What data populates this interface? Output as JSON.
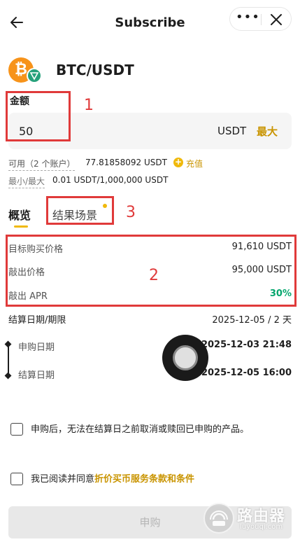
{
  "header": {
    "title": "Subscribe",
    "more_glyph": "•••",
    "back_icon": "arrow-left-icon",
    "close_icon": "close-icon"
  },
  "pair": {
    "name": "BTC/USDT",
    "base_glyph": "₿",
    "base_color": "#f7931a",
    "quote_color": "#26a17b"
  },
  "amount": {
    "label": "金额",
    "value": "50",
    "unit": "USDT",
    "max_label": "最大"
  },
  "available": {
    "label": "可用（2 个账户）",
    "value": "77.81858092 USDT",
    "recharge_label": "充值",
    "minmax_label": "最小/最大",
    "minmax_value": "0.01 USDT/1,000,000 USDT"
  },
  "tabs": [
    {
      "label": "概览",
      "active": true
    },
    {
      "label": "结果场景",
      "active": false
    }
  ],
  "details": [
    {
      "label": "目标购买价格",
      "value": "91,610 USDT"
    },
    {
      "label": "敲出价格",
      "value": "95,000 USDT"
    },
    {
      "label": "敲出 APR",
      "value": "30%"
    }
  ],
  "settlement": {
    "label": "结算日期/期限",
    "value": "2025-12-05 / 2 天"
  },
  "timeline": [
    {
      "label": "申购日期",
      "value": "2025-12-03 21:48"
    },
    {
      "label": "结算日期",
      "value": "2025-12-05 16:00"
    }
  ],
  "agreements": {
    "notice": "申购后，无法在结算日之前取消或赎回已申购的产品。",
    "read_prefix": "我已阅读并同意",
    "terms_link": "折价买币服务条款和条件"
  },
  "submit_label": "申购",
  "watermark": {
    "title": "路由器",
    "subtitle": "luyouqi.com"
  },
  "annotations": [
    "1",
    "2",
    "3"
  ],
  "colors": {
    "accent": "#f0b90b",
    "gold_text": "#c99400",
    "positive": "#03a66d",
    "annotation_red": "#e03a3a"
  }
}
